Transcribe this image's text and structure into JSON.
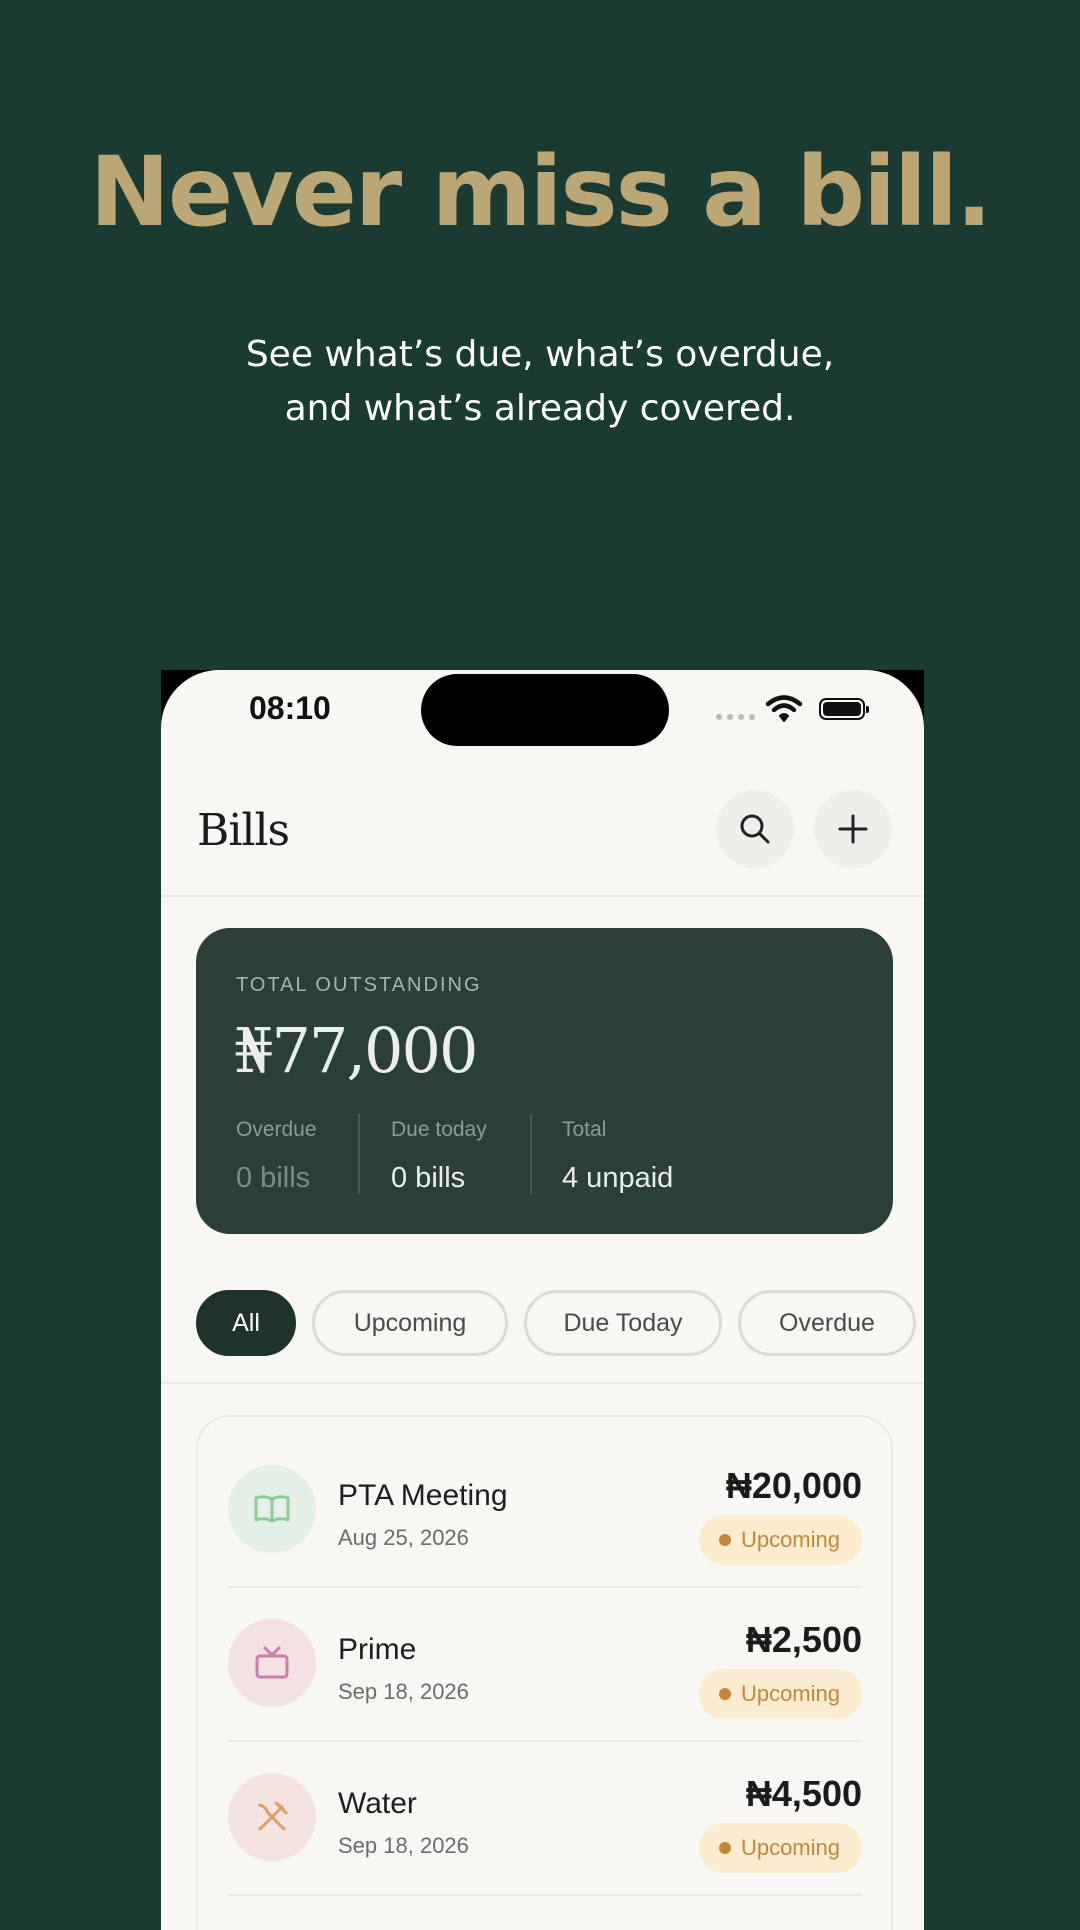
{
  "hero": {
    "headline": "Never miss a bill.",
    "subline_1": "See what’s due, what’s overdue,",
    "subline_2": "and what’s already covered."
  },
  "status_bar": {
    "time": "08:10"
  },
  "header": {
    "title": "Bills",
    "search_icon": "search-icon",
    "add_icon": "plus-icon"
  },
  "summary": {
    "label": "TOTAL OUTSTANDING",
    "amount": "₦77,000",
    "stats": [
      {
        "label": "Overdue",
        "value": "0 bills"
      },
      {
        "label": "Due today",
        "value": "0 bills"
      },
      {
        "label": "Total",
        "value": "4 unpaid"
      }
    ]
  },
  "filters": {
    "selected": "All",
    "items": [
      "All",
      "Upcoming",
      "Due Today",
      "Overdue"
    ]
  },
  "bills": [
    {
      "name": "PTA Meeting",
      "date": "Aug 25, 2026",
      "amount": "₦20,000",
      "status": "Upcoming",
      "icon": "book-icon",
      "icon_bg": "#e4efe5",
      "icon_color": "#8ccb95"
    },
    {
      "name": "Prime",
      "date": "Sep 18, 2026",
      "amount": "₦2,500",
      "status": "Upcoming",
      "icon": "tv-icon",
      "icon_bg": "#f3e1e4",
      "icon_color": "#c97fa8"
    },
    {
      "name": "Water",
      "date": "Sep 18, 2026",
      "amount": "₦4,500",
      "status": "Upcoming",
      "icon": "utensils-crossed-icon",
      "icon_bg": "#f4e3de",
      "icon_color": "#d7a067"
    }
  ],
  "colors": {
    "background": "#1a3a32",
    "headline": "#bba676",
    "summary_card": "#2c3e38",
    "badge_bg": "#fbecd0",
    "badge_text": "#c2873a"
  }
}
